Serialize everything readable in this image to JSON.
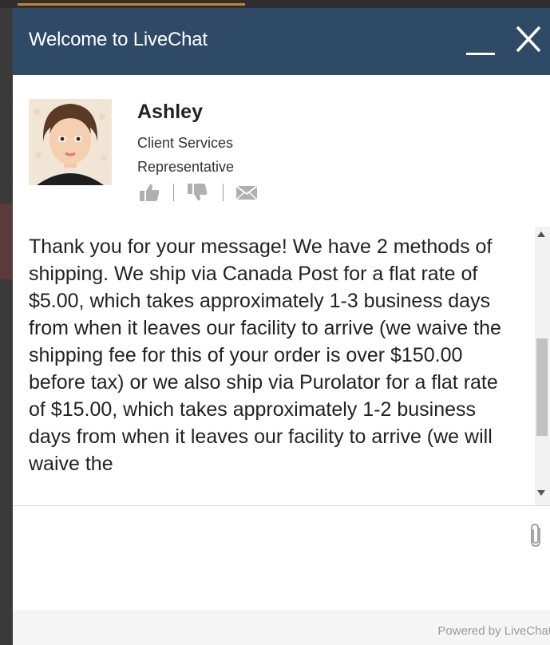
{
  "window": {
    "title": "Welcome to LiveChat"
  },
  "agent": {
    "name": "Ashley",
    "role_line1": "Client Services",
    "role_line2": "Representative"
  },
  "messages": [
    {
      "text": "Thank you for your message! We have 2 methods of shipping. We ship via Canada Post for a flat rate of $5.00, which takes approximately 1-3 business days from when it leaves our facility to arrive (we waive the shipping fee for this of your order is over $150.00 before tax) or we also ship via Purolator for a flat rate of $15.00, which takes approximately 1-2 business days from when it leaves our facility to arrive (we will waive the"
    }
  ],
  "composer": {
    "value": "",
    "placeholder": ""
  },
  "footer": {
    "powered_by": "Powered by LiveChat"
  },
  "icons": {
    "minimize": "minimize-icon",
    "close": "close-icon",
    "thumbs_up": "thumbs-up-icon",
    "thumbs_down": "thumbs-down-icon",
    "email": "email-icon",
    "attach": "paperclip-icon"
  },
  "colors": {
    "header_bg": "#2e4a66",
    "header_text": "#ffffff",
    "body_bg": "#ffffff",
    "footer_bg": "#f5f5f5",
    "icon_gray": "#b0b0b0"
  }
}
